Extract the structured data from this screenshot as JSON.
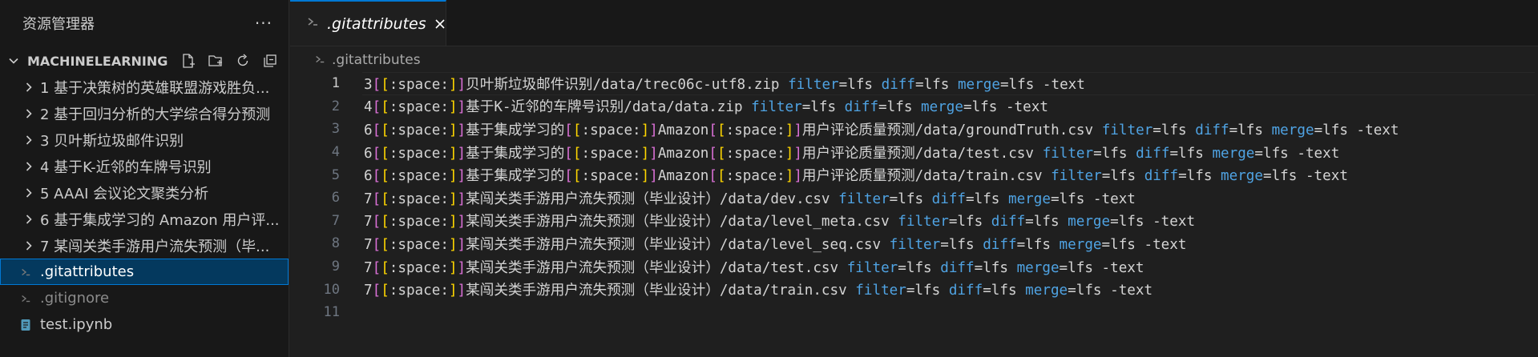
{
  "explorer": {
    "title": "资源管理器",
    "more": "···",
    "section_label": "MACHINELEARNING",
    "items": [
      {
        "label": "1 基于决策树的英雄联盟游戏胜负...",
        "type": "folder"
      },
      {
        "label": "2 基于回归分析的大学综合得分预测",
        "type": "folder"
      },
      {
        "label": "3 贝叶斯垃圾邮件识别",
        "type": "folder"
      },
      {
        "label": "4 基于K-近邻的车牌号识别",
        "type": "folder"
      },
      {
        "label": "5 AAAI 会议论文聚类分析",
        "type": "folder"
      },
      {
        "label": "6 基于集成学习的 Amazon 用户评...",
        "type": "folder"
      },
      {
        "label": "7 某闯关类手游用户流失预测（毕...",
        "type": "folder"
      },
      {
        "label": ".gitattributes",
        "type": "file",
        "selected": true
      },
      {
        "label": ".gitignore",
        "type": "file",
        "dim": true
      },
      {
        "label": "test.ipynb",
        "type": "file"
      }
    ]
  },
  "tab": {
    "label": ".gitattributes"
  },
  "breadcrumb": {
    "file": ".gitattributes"
  },
  "code": {
    "lines": [
      {
        "n": "1",
        "segs": [
          [
            "t",
            "3"
          ],
          [
            "b1",
            "["
          ],
          [
            "b2",
            "["
          ],
          [
            "t",
            ":space:"
          ],
          [
            "b2",
            "]"
          ],
          [
            "b1",
            "]"
          ],
          [
            "t",
            "贝叶斯垃圾邮件识别/data/trec06c-utf8.zip "
          ],
          [
            "k",
            "filter"
          ],
          [
            "t",
            "=lfs "
          ],
          [
            "k",
            "diff"
          ],
          [
            "t",
            "=lfs "
          ],
          [
            "k",
            "merge"
          ],
          [
            "t",
            "=lfs -text"
          ]
        ]
      },
      {
        "n": "2",
        "segs": [
          [
            "t",
            "4"
          ],
          [
            "b1",
            "["
          ],
          [
            "b2",
            "["
          ],
          [
            "t",
            ":space:"
          ],
          [
            "b2",
            "]"
          ],
          [
            "b1",
            "]"
          ],
          [
            "t",
            "基于K-近邻的车牌号识别/data/data.zip "
          ],
          [
            "k",
            "filter"
          ],
          [
            "t",
            "=lfs "
          ],
          [
            "k",
            "diff"
          ],
          [
            "t",
            "=lfs "
          ],
          [
            "k",
            "merge"
          ],
          [
            "t",
            "=lfs -text"
          ]
        ]
      },
      {
        "n": "3",
        "segs": [
          [
            "t",
            "6"
          ],
          [
            "b1",
            "["
          ],
          [
            "b2",
            "["
          ],
          [
            "t",
            ":space:"
          ],
          [
            "b2",
            "]"
          ],
          [
            "b1",
            "]"
          ],
          [
            "t",
            "基于集成学习的"
          ],
          [
            "b1",
            "["
          ],
          [
            "b2",
            "["
          ],
          [
            "t",
            ":space:"
          ],
          [
            "b2",
            "]"
          ],
          [
            "b1",
            "]"
          ],
          [
            "t",
            "Amazon"
          ],
          [
            "b1",
            "["
          ],
          [
            "b2",
            "["
          ],
          [
            "t",
            ":space:"
          ],
          [
            "b2",
            "]"
          ],
          [
            "b1",
            "]"
          ],
          [
            "t",
            "用户评论质量预测/data/groundTruth.csv "
          ],
          [
            "k",
            "filter"
          ],
          [
            "t",
            "=lfs "
          ],
          [
            "k",
            "diff"
          ],
          [
            "t",
            "=lfs "
          ],
          [
            "k",
            "merge"
          ],
          [
            "t",
            "=lfs -text"
          ]
        ]
      },
      {
        "n": "4",
        "segs": [
          [
            "t",
            "6"
          ],
          [
            "b1",
            "["
          ],
          [
            "b2",
            "["
          ],
          [
            "t",
            ":space:"
          ],
          [
            "b2",
            "]"
          ],
          [
            "b1",
            "]"
          ],
          [
            "t",
            "基于集成学习的"
          ],
          [
            "b1",
            "["
          ],
          [
            "b2",
            "["
          ],
          [
            "t",
            ":space:"
          ],
          [
            "b2",
            "]"
          ],
          [
            "b1",
            "]"
          ],
          [
            "t",
            "Amazon"
          ],
          [
            "b1",
            "["
          ],
          [
            "b2",
            "["
          ],
          [
            "t",
            ":space:"
          ],
          [
            "b2",
            "]"
          ],
          [
            "b1",
            "]"
          ],
          [
            "t",
            "用户评论质量预测/data/test.csv "
          ],
          [
            "k",
            "filter"
          ],
          [
            "t",
            "=lfs "
          ],
          [
            "k",
            "diff"
          ],
          [
            "t",
            "=lfs "
          ],
          [
            "k",
            "merge"
          ],
          [
            "t",
            "=lfs -text"
          ]
        ]
      },
      {
        "n": "5",
        "segs": [
          [
            "t",
            "6"
          ],
          [
            "b1",
            "["
          ],
          [
            "b2",
            "["
          ],
          [
            "t",
            ":space:"
          ],
          [
            "b2",
            "]"
          ],
          [
            "b1",
            "]"
          ],
          [
            "t",
            "基于集成学习的"
          ],
          [
            "b1",
            "["
          ],
          [
            "b2",
            "["
          ],
          [
            "t",
            ":space:"
          ],
          [
            "b2",
            "]"
          ],
          [
            "b1",
            "]"
          ],
          [
            "t",
            "Amazon"
          ],
          [
            "b1",
            "["
          ],
          [
            "b2",
            "["
          ],
          [
            "t",
            ":space:"
          ],
          [
            "b2",
            "]"
          ],
          [
            "b1",
            "]"
          ],
          [
            "t",
            "用户评论质量预测/data/train.csv "
          ],
          [
            "k",
            "filter"
          ],
          [
            "t",
            "=lfs "
          ],
          [
            "k",
            "diff"
          ],
          [
            "t",
            "=lfs "
          ],
          [
            "k",
            "merge"
          ],
          [
            "t",
            "=lfs -text"
          ]
        ]
      },
      {
        "n": "6",
        "segs": [
          [
            "t",
            "7"
          ],
          [
            "b1",
            "["
          ],
          [
            "b2",
            "["
          ],
          [
            "t",
            ":space:"
          ],
          [
            "b2",
            "]"
          ],
          [
            "b1",
            "]"
          ],
          [
            "t",
            "某闯关类手游用户流失预测（毕业设计）/data/dev.csv "
          ],
          [
            "k",
            "filter"
          ],
          [
            "t",
            "=lfs "
          ],
          [
            "k",
            "diff"
          ],
          [
            "t",
            "=lfs "
          ],
          [
            "k",
            "merge"
          ],
          [
            "t",
            "=lfs -text"
          ]
        ]
      },
      {
        "n": "7",
        "segs": [
          [
            "t",
            "7"
          ],
          [
            "b1",
            "["
          ],
          [
            "b2",
            "["
          ],
          [
            "t",
            ":space:"
          ],
          [
            "b2",
            "]"
          ],
          [
            "b1",
            "]"
          ],
          [
            "t",
            "某闯关类手游用户流失预测（毕业设计）/data/level_meta.csv "
          ],
          [
            "k",
            "filter"
          ],
          [
            "t",
            "=lfs "
          ],
          [
            "k",
            "diff"
          ],
          [
            "t",
            "=lfs "
          ],
          [
            "k",
            "merge"
          ],
          [
            "t",
            "=lfs -text"
          ]
        ]
      },
      {
        "n": "8",
        "segs": [
          [
            "t",
            "7"
          ],
          [
            "b1",
            "["
          ],
          [
            "b2",
            "["
          ],
          [
            "t",
            ":space:"
          ],
          [
            "b2",
            "]"
          ],
          [
            "b1",
            "]"
          ],
          [
            "t",
            "某闯关类手游用户流失预测（毕业设计）/data/level_seq.csv "
          ],
          [
            "k",
            "filter"
          ],
          [
            "t",
            "=lfs "
          ],
          [
            "k",
            "diff"
          ],
          [
            "t",
            "=lfs "
          ],
          [
            "k",
            "merge"
          ],
          [
            "t",
            "=lfs -text"
          ]
        ]
      },
      {
        "n": "9",
        "segs": [
          [
            "t",
            "7"
          ],
          [
            "b1",
            "["
          ],
          [
            "b2",
            "["
          ],
          [
            "t",
            ":space:"
          ],
          [
            "b2",
            "]"
          ],
          [
            "b1",
            "]"
          ],
          [
            "t",
            "某闯关类手游用户流失预测（毕业设计）/data/test.csv "
          ],
          [
            "k",
            "filter"
          ],
          [
            "t",
            "=lfs "
          ],
          [
            "k",
            "diff"
          ],
          [
            "t",
            "=lfs "
          ],
          [
            "k",
            "merge"
          ],
          [
            "t",
            "=lfs -text"
          ]
        ]
      },
      {
        "n": "10",
        "segs": [
          [
            "t",
            "7"
          ],
          [
            "b1",
            "["
          ],
          [
            "b2",
            "["
          ],
          [
            "t",
            ":space:"
          ],
          [
            "b2",
            "]"
          ],
          [
            "b1",
            "]"
          ],
          [
            "t",
            "某闯关类手游用户流失预测（毕业设计）/data/train.csv "
          ],
          [
            "k",
            "filter"
          ],
          [
            "t",
            "=lfs "
          ],
          [
            "k",
            "diff"
          ],
          [
            "t",
            "=lfs "
          ],
          [
            "k",
            "merge"
          ],
          [
            "t",
            "=lfs -text"
          ]
        ]
      },
      {
        "n": "11",
        "segs": []
      }
    ]
  },
  "colors": {
    "accent": "#0078d4",
    "selection": "#04395e",
    "keyword": "#4fa3e3",
    "bracket_outer": "#da70d6",
    "bracket_inner": "#ffd700"
  }
}
